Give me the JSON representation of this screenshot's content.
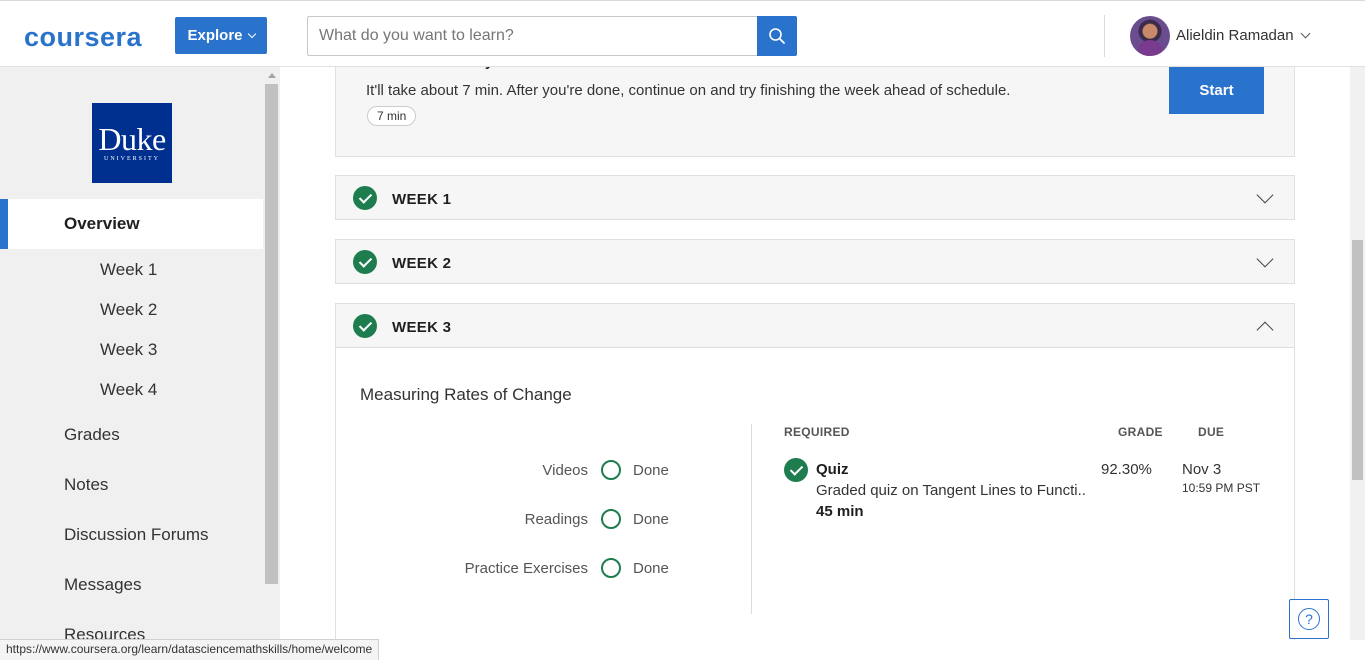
{
  "header": {
    "logo_text": "coursera",
    "explore_label": "Explore",
    "search_placeholder": "What do you want to learn?",
    "user_name": "Alieldin Ramadan"
  },
  "sidebar": {
    "university_logo": {
      "line1": "Duke",
      "line2": "UNIVERSITY"
    },
    "overview_label": "Overview",
    "weeks": [
      "Week 1",
      "Week 2",
      "Week 3",
      "Week 4"
    ],
    "items": [
      "Grades",
      "Notes",
      "Discussion Forums",
      "Messages",
      "Resources"
    ]
  },
  "next_item": {
    "title": "Video: Probability Definitions and Notation",
    "description": "It'll take about 7 min. After you're done, continue on and try finishing the week ahead of schedule.",
    "duration": "7 min",
    "start_label": "Start"
  },
  "weeks": [
    {
      "label": "WEEK 1",
      "completed": true,
      "expanded": false
    },
    {
      "label": "WEEK 2",
      "completed": true,
      "expanded": false
    },
    {
      "label": "WEEK 3",
      "completed": true,
      "expanded": true
    }
  ],
  "week3": {
    "module_title": "Measuring Rates of Change",
    "progress": [
      {
        "label": "Videos",
        "status": "Done"
      },
      {
        "label": "Readings",
        "status": "Done"
      },
      {
        "label": "Practice Exercises",
        "status": "Done"
      }
    ],
    "columns": {
      "required": "REQUIRED",
      "grade": "GRADE",
      "due": "DUE"
    },
    "quiz": {
      "type": "Quiz",
      "name": "Graded quiz on Tangent Lines to Functi...",
      "duration": "45 min",
      "grade": "92.30%",
      "due_date": "Nov 3",
      "due_time": "10:59 PM PST"
    }
  },
  "status_bar_url": "https://www.coursera.org/learn/datasciencemathskills/home/welcome",
  "colors": {
    "brand_blue": "#2a73cc",
    "success_green": "#1e7d4f",
    "duke_blue": "#00308f"
  }
}
